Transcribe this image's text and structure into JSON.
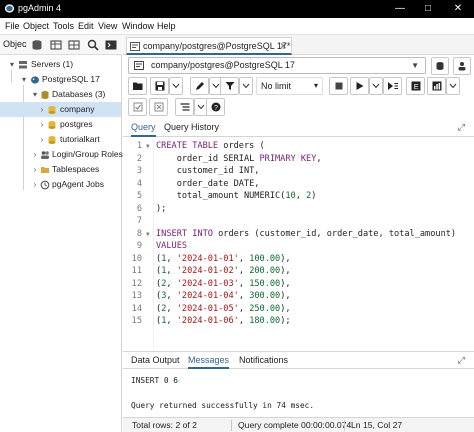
{
  "window": {
    "title": "pgAdmin 4",
    "controls": [
      "—",
      "□",
      "✕"
    ]
  },
  "menu": [
    "File",
    "Object",
    "Tools",
    "Edit",
    "View",
    "Window",
    "Help"
  ],
  "object_explorer": {
    "label": "Objec",
    "tree": [
      {
        "label": "Servers (1)"
      },
      {
        "label": "PostgreSQL 17"
      },
      {
        "label": "Databases (3)"
      },
      {
        "label": "company"
      },
      {
        "label": "postgres"
      },
      {
        "label": "tutorialkart"
      },
      {
        "label": "Login/Group Roles"
      },
      {
        "label": "Tablespaces"
      },
      {
        "label": "pgAgent Jobs"
      }
    ]
  },
  "query_tab": {
    "title": "company/postgres@PostgreSQL 17*",
    "close": "✕"
  },
  "connection": {
    "value": "company/postgres@PostgreSQL 17"
  },
  "toolbar": {
    "limit_label": "No limit"
  },
  "editor_tabs": [
    "Query",
    "Query History"
  ],
  "editor": {
    "line_numbers": [
      "1",
      "2",
      "3",
      "4",
      "5",
      "6",
      "7",
      "8",
      "9",
      "10",
      "11",
      "12",
      "13",
      "14",
      "15"
    ]
  },
  "result_tabs": [
    "Data Output",
    "Messages",
    "Notifications"
  ],
  "messages": {
    "line1": "INSERT 0 6",
    "line2": "Query returned successfully in 74 msec."
  },
  "status": {
    "total_rows": "Total rows: 2 of 2",
    "query_complete": "Query complete 00:00:00.074",
    "cursor": "Ln 15, Col 27"
  },
  "colors": {
    "accent": "#326690",
    "keyword": "#7a1f74",
    "number": "#0b6b2d",
    "string": "#a31515",
    "selection": "#cfe3f5"
  }
}
